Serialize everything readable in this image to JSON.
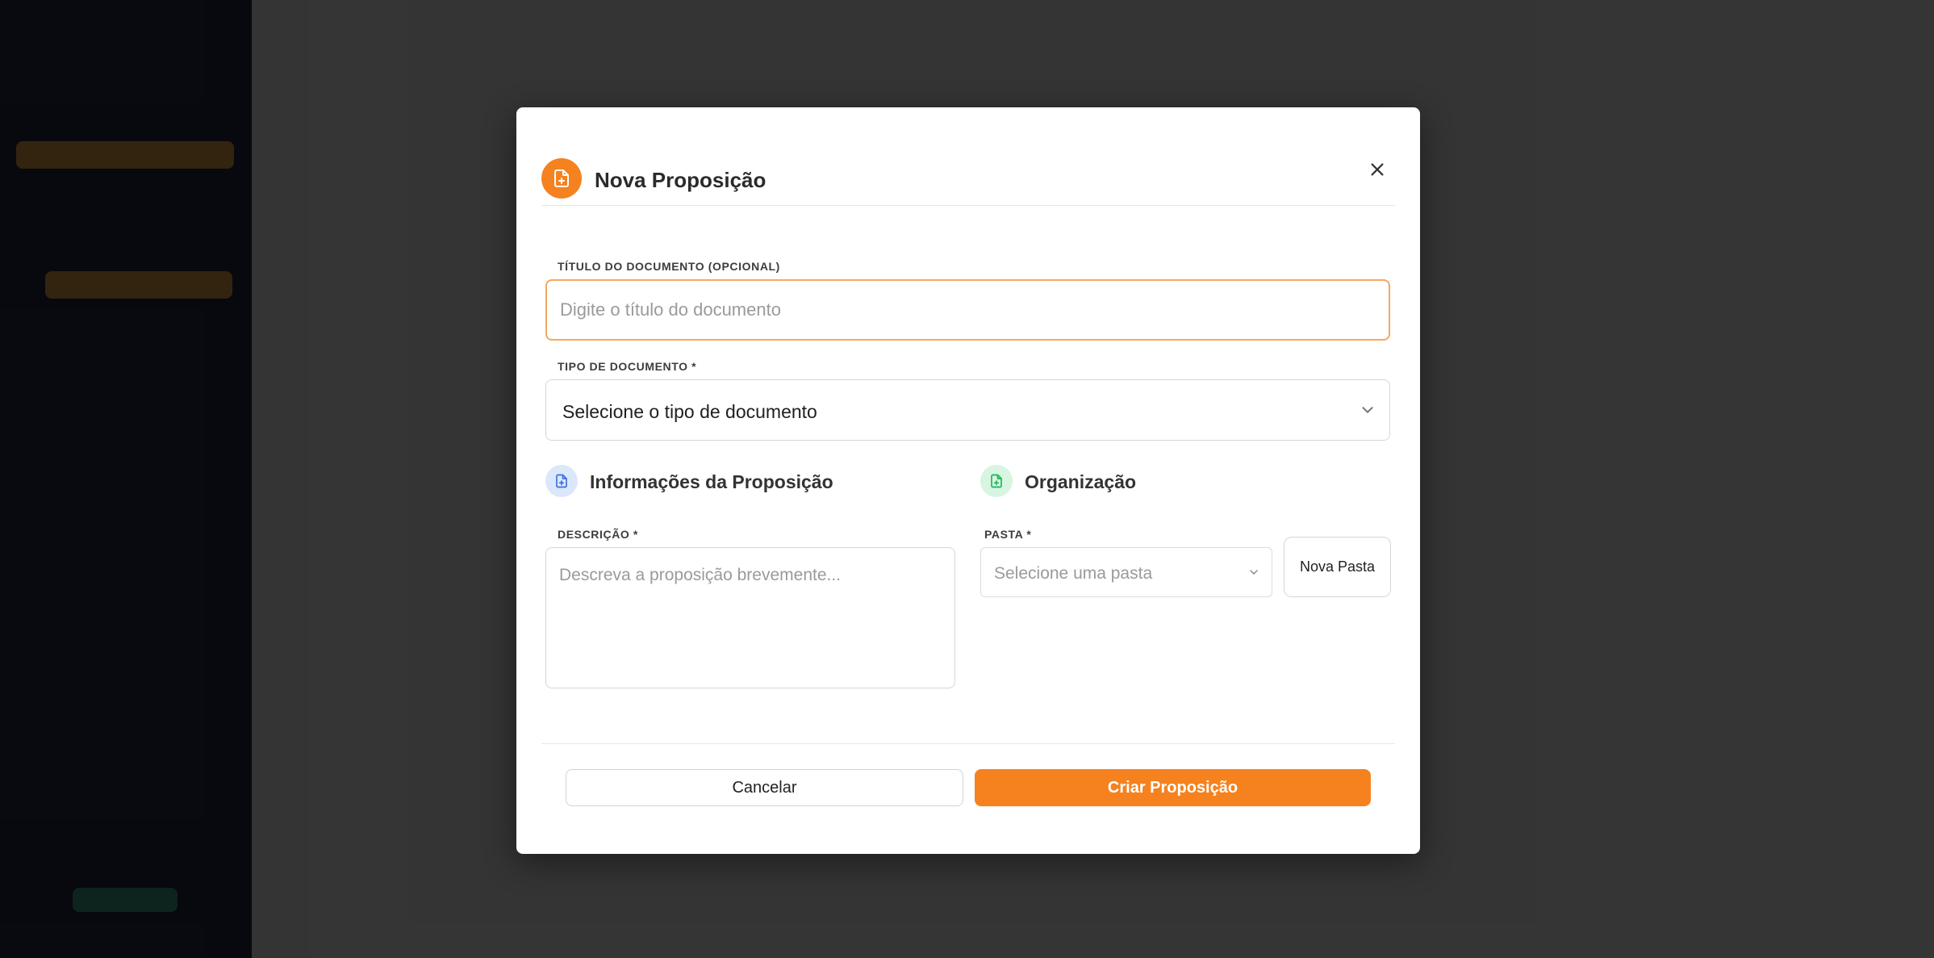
{
  "modal": {
    "title": "Nova Proposição",
    "title_field": {
      "label": "TÍTULO DO DOCUMENTO (OPCIONAL)",
      "placeholder": "Digite o título do documento",
      "value": ""
    },
    "type_field": {
      "label": "TIPO DE DOCUMENTO *",
      "selected": "Selecione o tipo de documento"
    },
    "info_section": {
      "title": "Informações da Proposição",
      "description": {
        "label": "DESCRIÇÃO *",
        "placeholder": "Descreva a proposição brevemente..."
      }
    },
    "org_section": {
      "title": "Organização",
      "folder": {
        "label": "PASTA *",
        "selected": "Selecione uma pasta"
      },
      "new_folder_label": "Nova Pasta"
    },
    "footer": {
      "cancel_label": "Cancelar",
      "create_label": "Criar Proposição"
    }
  },
  "colors": {
    "accent": "#f5821f",
    "info_icon_bg": "#dbe7fb",
    "info_icon": "#3b6fe0",
    "org_icon_bg": "#d7f5e1",
    "org_icon": "#22b35a"
  },
  "icons": {
    "header": "file-plus-icon",
    "close": "close-icon",
    "info": "file-plus-icon",
    "org": "file-plus-icon",
    "select": "chevron-down-icon"
  }
}
